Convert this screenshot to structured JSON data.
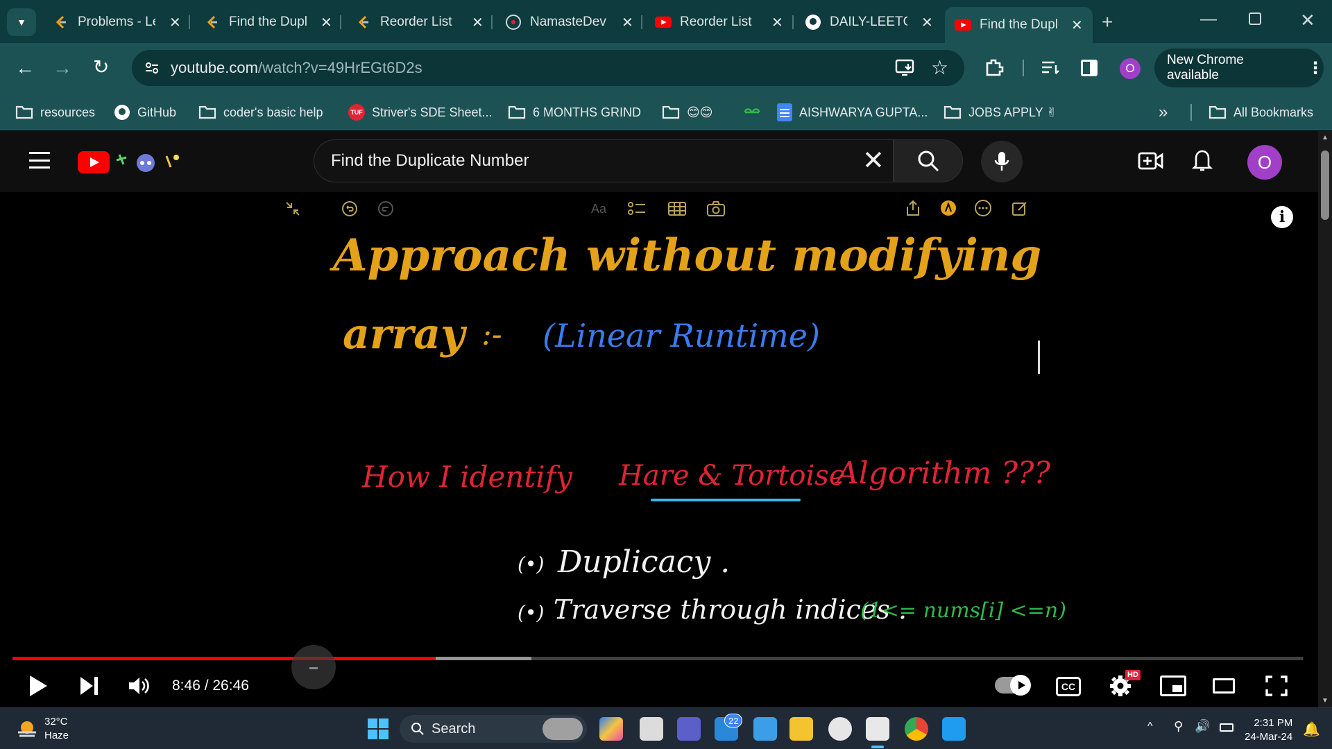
{
  "browser": {
    "tabs": [
      {
        "title": "Problems - LeetCode",
        "icon": "leetcode-icon",
        "active": false
      },
      {
        "title": "Find the Duplicate",
        "icon": "leetcode-icon",
        "active": false
      },
      {
        "title": "Reorder List",
        "icon": "leetcode-icon",
        "active": false
      },
      {
        "title": "NamasteDev",
        "icon": "namastedev-icon",
        "active": false
      },
      {
        "title": "Reorder List",
        "icon": "youtube-icon",
        "active": false
      },
      {
        "title": "DAILY-LEETCODE",
        "icon": "github-icon",
        "active": false
      },
      {
        "title": "Find the Duplicate",
        "icon": "youtube-icon",
        "active": true
      }
    ],
    "url_host": "youtube.com",
    "url_path": "/watch?v=49HrEGt6D2s",
    "profile_initial": "O",
    "new_chrome_label": "New Chrome available",
    "bookmarks": [
      {
        "label": "resources",
        "icon": "folder-icon"
      },
      {
        "label": "GitHub",
        "icon": "github-icon"
      },
      {
        "label": "coder's basic help",
        "icon": "folder-icon"
      },
      {
        "label": "Striver's SDE Sheet...",
        "icon": "tuf-icon"
      },
      {
        "label": "6 MONTHS GRIND",
        "icon": "folder-icon"
      },
      {
        "label": "😊😊",
        "icon": "folder-icon"
      },
      {
        "label": "",
        "icon": "gfg-icon"
      },
      {
        "label": "AISHWARYA GUPTA...",
        "icon": "docs-icon"
      },
      {
        "label": "JOBS APPLY ✌",
        "icon": "folder-icon"
      }
    ],
    "all_bookmarks_label": "All Bookmarks",
    "more_label": "»"
  },
  "youtube": {
    "search_value": "Find the Duplicate Number",
    "avatar_initial": "O"
  },
  "video": {
    "line1": "Approach without modifying",
    "line2a": "array",
    "line2b": ":-",
    "line2c": "(Linear Runtime)",
    "q_how": "How I identify",
    "q_ht": "Hare & Tortoise",
    "q_alg": "Algorithm ???",
    "bullet1_dot": "(•)",
    "bullet1": "Duplicacy .",
    "bullet2_dot": "(•)",
    "bullet2": "Traverse through indices .",
    "bullet2_note": "(1<= nums[i] <=n)",
    "colors": {
      "gold": "#e3a21a",
      "blue": "#3a7bf0",
      "red": "#e02434",
      "cyan": "#3fb6e8",
      "green": "#2fb84a",
      "white": "#f2f2f2"
    }
  },
  "player": {
    "time": "8:46 / 26:46",
    "played_fraction": 0.328,
    "buffered_fraction": 0.402,
    "hd_badge": "HD",
    "cc_label": "CC"
  },
  "taskbar": {
    "temp": "32°C",
    "weather": "Haze",
    "search_label": "Search",
    "mail_badge": "22",
    "time": "2:31 PM",
    "date": "24-Mar-24"
  }
}
